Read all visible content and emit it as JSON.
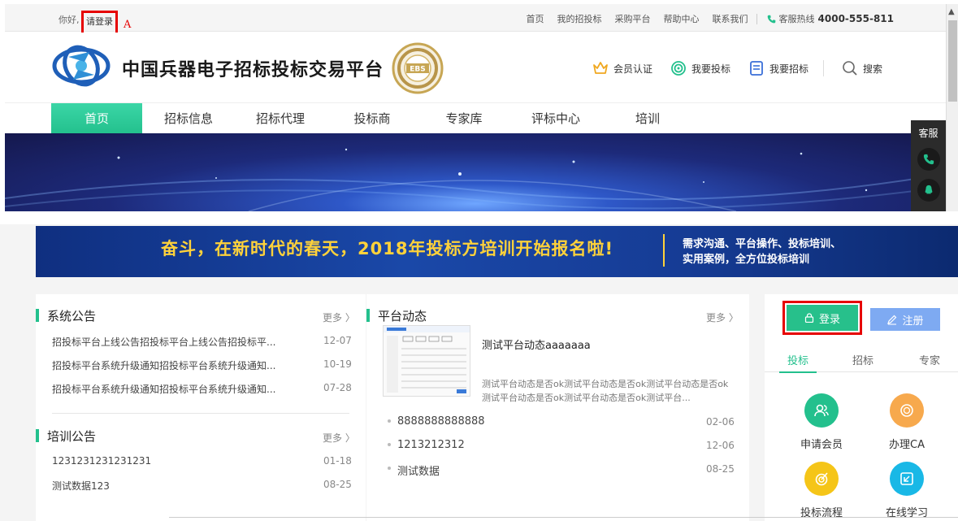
{
  "topbar": {
    "greeting": "你好,",
    "login_link": "请登录",
    "annotation": "A",
    "links": [
      "首页",
      "我的招投标",
      "采购平台",
      "帮助中心",
      "联系我们"
    ],
    "hotline_label": "客服热线",
    "hotline_number": "4000-555-811"
  },
  "header": {
    "site_title": "中国兵器电子招标投标交易平台",
    "badge_text": "EBS",
    "actions": {
      "member": "会员认证",
      "bid": "我要投标",
      "tender": "我要招标",
      "search": "搜索"
    }
  },
  "nav": {
    "items": [
      "首页",
      "招标信息",
      "招标代理",
      "投标商",
      "专家库",
      "评标中心",
      "培训"
    ],
    "active_index": 0
  },
  "service_widget": {
    "title": "客服"
  },
  "promo": {
    "main": "奋斗，在新时代的春天，2018年投标方培训开始报名啦!",
    "sub_line1": "需求沟通、平台操作、投标培训、",
    "sub_line2": "实用案例，全方位投标培训"
  },
  "system_notice": {
    "title": "系统公告",
    "more": "更多 〉",
    "items": [
      {
        "text": "招投标平台上线公告招投标平台上线公告招投标平...",
        "date": "12-07"
      },
      {
        "text": "招投标平台系统升级通知招投标平台系统升级通知...",
        "date": "10-19"
      },
      {
        "text": "招投标平台系统升级通知招投标平台系统升级通知...",
        "date": "07-28"
      }
    ]
  },
  "training_notice": {
    "title": "培训公告",
    "more": "更多 〉",
    "items": [
      {
        "text": "1231231231231231",
        "date": "01-18"
      },
      {
        "text": "测试数据123",
        "date": "08-25"
      }
    ]
  },
  "platform_news": {
    "title": "平台动态",
    "more": "更多 〉",
    "featured_title": "测试平台动态aaaaaaa",
    "featured_desc": "测试平台动态是否ok测试平台动态是否ok测试平台动态是否ok测试平台动态是否ok测试平台动态是否ok测试平台...",
    "items": [
      {
        "text": "8888888888888",
        "date": "02-06"
      },
      {
        "text": "1213212312",
        "date": "12-06"
      },
      {
        "text": "测试数据",
        "date": "08-25"
      }
    ]
  },
  "user_panel": {
    "login": "登录",
    "register": "注册",
    "tabs": [
      "投标",
      "招标",
      "专家"
    ],
    "active_tab": 0,
    "services": [
      {
        "label": "申请会员",
        "color": "#23c08d",
        "icon": "users-icon"
      },
      {
        "label": "办理CA",
        "color": "#f7a94d",
        "icon": "ca-icon"
      },
      {
        "label": "投标流程",
        "color": "#f5c518",
        "icon": "target-icon"
      },
      {
        "label": "在线学习",
        "color": "#19b8e6",
        "icon": "study-icon"
      }
    ]
  },
  "colors": {
    "accent": "#23c08d",
    "highlight_border": "#e60000",
    "register": "#7eaaf2"
  }
}
